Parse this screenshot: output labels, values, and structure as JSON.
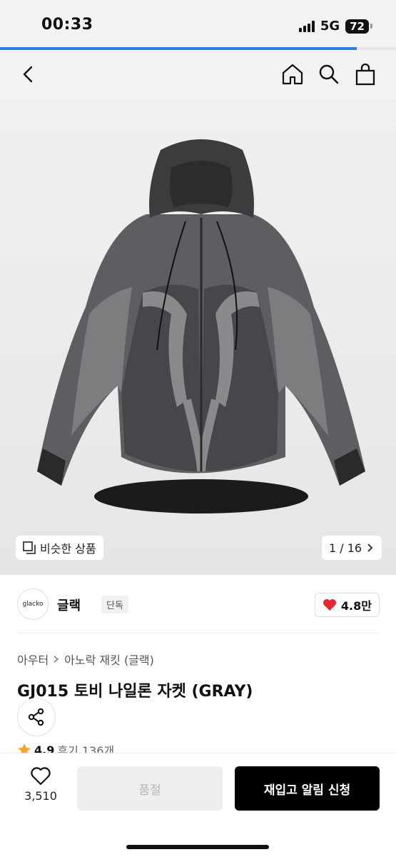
{
  "status_bar": {
    "time": "00:33",
    "network": "5G",
    "battery": "72"
  },
  "page_load": {
    "progress": 0.9
  },
  "top_nav": {
    "icons": [
      "back-icon",
      "home-icon",
      "search-icon",
      "bag-icon"
    ]
  },
  "hero": {
    "similar_label": "비슷한 상품",
    "image_counter": "1 / 16"
  },
  "brand": {
    "logo_text": "glacko",
    "name": "글랙",
    "tag": "단독",
    "likes": "4.8만"
  },
  "breadcrumb": {
    "category": "아우터",
    "subcategory": "아노락 재킷 (글랙)"
  },
  "product": {
    "title": "GJ015 토비 나일론 자켓 (GRAY)",
    "rating": "4.9",
    "reviews": "후기 136개"
  },
  "bottom_bar": {
    "favorite_count": "3,510",
    "soldout_label": "품절",
    "restock_label": "재입고 알림 신청"
  },
  "colors": {
    "accent": "#2a7de1",
    "heart": "#e8262f",
    "star": "#f5a623"
  }
}
